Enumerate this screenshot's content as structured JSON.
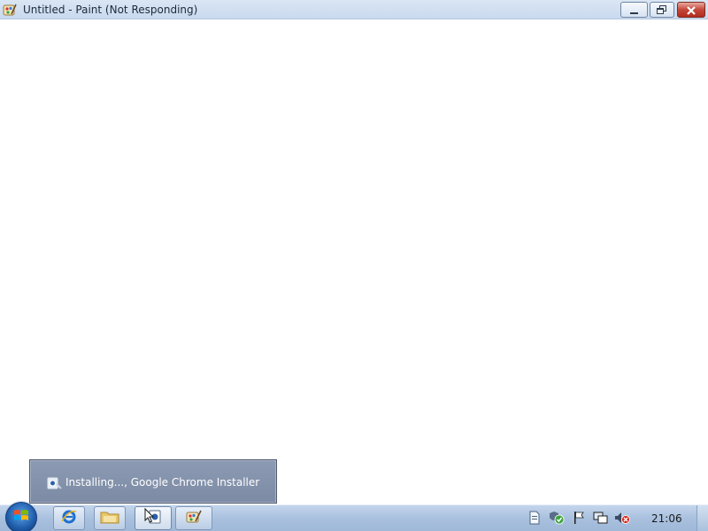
{
  "window": {
    "title": "Untitled - Paint (Not Responding)",
    "app_icon": "paint-icon",
    "controls": {
      "minimize": "minimize-icon",
      "maximize": "restore-icon",
      "close": "close-icon"
    }
  },
  "notification": {
    "icon": "installer-icon",
    "text": "Installing..., Google Chrome Installer"
  },
  "taskbar": {
    "start": "windows-start-icon",
    "pinned": [
      {
        "name": "internet-explorer",
        "icon": "ie-icon"
      },
      {
        "name": "windows-explorer",
        "icon": "folder-icon"
      },
      {
        "name": "chrome-installer",
        "icon": "installer-icon"
      },
      {
        "name": "paint",
        "icon": "paint-icon"
      }
    ],
    "tray": [
      "document-icon",
      "security-check-icon",
      "action-center-flag-icon",
      "network-icon",
      "volume-muted-icon"
    ],
    "clock": "21:06"
  },
  "colors": {
    "titlebar": "#c9d9ee",
    "taskbar": "#a9c1de",
    "balloon": "#7c8aa3",
    "close_button": "#c3473a"
  }
}
